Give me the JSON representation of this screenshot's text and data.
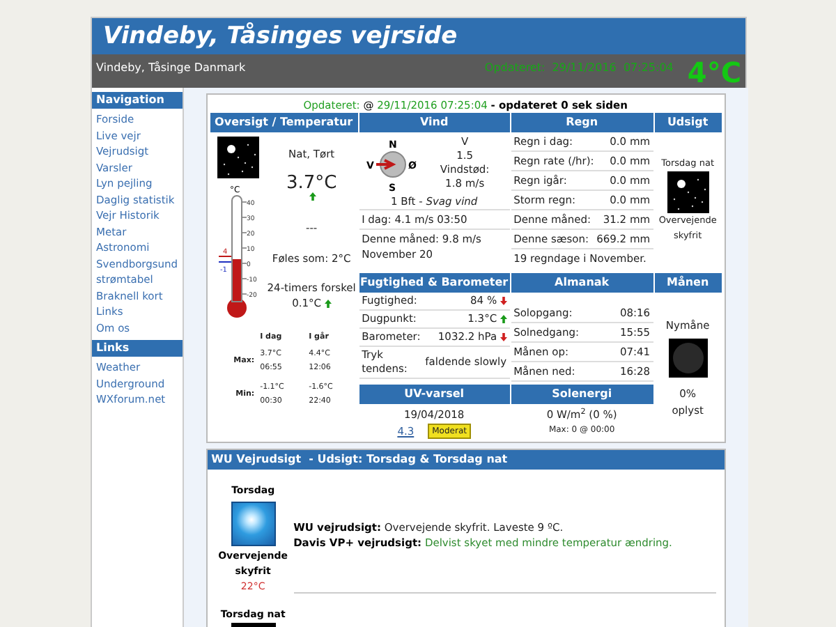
{
  "header": {
    "title": "Vindeby, Tåsinges vejrside",
    "location": "Vindeby, Tåsinge Danmark",
    "updated": "Opdateret:  29/11/2016  07:25:04",
    "temperature": "4°C"
  },
  "sidebar": [
    {
      "title": "Navigation",
      "items": [
        "Forside",
        "Live vejr",
        "Vejrudsigt",
        "Varsler",
        "Lyn pejling",
        "Daglig statistik",
        "Vejr Historik",
        "Metar",
        "Astronomi",
        "Svendborgsund strømtabel",
        "Braknell kort",
        "Links",
        "Om os"
      ]
    },
    {
      "title": "Links",
      "items": [
        "Weather Underground",
        "WXforum.net"
      ]
    }
  ],
  "updated": {
    "label": "Opdateret:",
    "at": "@",
    "time": "29/11/2016 07:25:04",
    "suffix": "- opdateret 0 sek siden"
  },
  "overview": {
    "title": "Oversigt / Temperatur",
    "condition": "Nat, Tørt",
    "temp": "3.7°C",
    "rising": true,
    "dash": "---",
    "feels": "Føles som: 2°C",
    "diff_label": "24-timers forskel",
    "diff": "0.1°C",
    "diff_rising": true,
    "thermometer": {
      "unit": "°C",
      "ticks": [
        "40",
        "30",
        "20",
        "10",
        "0",
        "-10",
        "-20"
      ],
      "level": 0.4,
      "high": "4",
      "low": "-1"
    },
    "columns": [
      "I dag",
      "I går"
    ],
    "rows": [
      {
        "label": "Max:",
        "values": [
          [
            "3.7°C",
            "06:55"
          ],
          [
            "4.4°C",
            "12:06"
          ]
        ]
      },
      {
        "label": "Min:",
        "values": [
          [
            "-1.1°C",
            "00:30"
          ],
          [
            "-1.6°C",
            "22:40"
          ]
        ]
      }
    ]
  },
  "wind": {
    "title": "Vind",
    "compass": [
      "N",
      "Ø",
      "S",
      "V"
    ],
    "direction": "V",
    "speed": "1.5",
    "gust_label": "Vindstød:",
    "gust": "1.8 m/s",
    "beaufort": "1 Bft -",
    "description": "Svag vind",
    "rows": [
      "I dag: 4.1 m/s 03:50",
      "Denne måned: 9.8 m/s November 20"
    ]
  },
  "humidity": {
    "title": "Fugtighed & Barometer",
    "rows": [
      {
        "label": "Fugtighed:",
        "value": "84 %",
        "rising": false
      },
      {
        "label": "Dugpunkt:",
        "value": "1.3°C",
        "rising": true
      },
      {
        "label": "Barometer:",
        "value": "1032.2 hPa",
        "rising": false
      },
      {
        "label": "Tryk tendens:",
        "value": "faldende slowly"
      }
    ]
  },
  "uv": {
    "title": "UV-varsel",
    "date": "19/04/2018",
    "index": "4.3",
    "badge": "Moderat"
  },
  "rain": {
    "title": "Regn",
    "rows": [
      {
        "label": "Regn i dag:",
        "value": "0.0 mm"
      },
      {
        "label": "Regn rate (/hr):",
        "value": "0.0 mm"
      },
      {
        "label": "Regn igår:",
        "value": "0.0 mm"
      },
      {
        "label": "Storm regn:",
        "value": "0.0 mm"
      },
      {
        "label": "Denne måned:",
        "value": "31.2 mm"
      },
      {
        "label": "Denne sæson:",
        "value": "669.2 mm"
      }
    ],
    "note": "19 regndage i November."
  },
  "almanac": {
    "title": "Almanak",
    "rows": [
      {
        "label": "Solopgang:",
        "value": "08:16"
      },
      {
        "label": "Solnedgang:",
        "value": "15:55"
      },
      {
        "label": "Månen op:",
        "value": "07:41"
      },
      {
        "label": "Månen ned:",
        "value": "16:28"
      }
    ]
  },
  "solar": {
    "title": "Solenergi",
    "value": "0 W/m$^{2}$ (0 %)",
    "max": "Max: 0 @  00:00"
  },
  "outlook": {
    "title": "Udsigt",
    "period": "Torsdag nat",
    "condition": "Overvejende skyfrit"
  },
  "moon": {
    "title": "Månen",
    "phase": "Nymåne",
    "lit": "0%",
    "lit_label": "oplyst"
  },
  "forecast": {
    "title": "WU Vejrudsigt  - Udsigt: Torsdag & Torsdag nat",
    "days": [
      {
        "name": "Torsdag",
        "kind": "day",
        "condition": "Overvejende skyfrit",
        "temp": "22°C"
      },
      {
        "name": "Torsdag nat",
        "kind": "night"
      }
    ],
    "lines": [
      {
        "label": "WU vejrudsigt:",
        "text": "Overvejende skyfrit. Laveste 9 ºC.",
        "color": "#222222"
      },
      {
        "label": "Davis VP+ vejrudsigt:",
        "text": "Delvist skyet med mindre temperatur ændring.",
        "color": "#2e8b2e"
      }
    ]
  }
}
